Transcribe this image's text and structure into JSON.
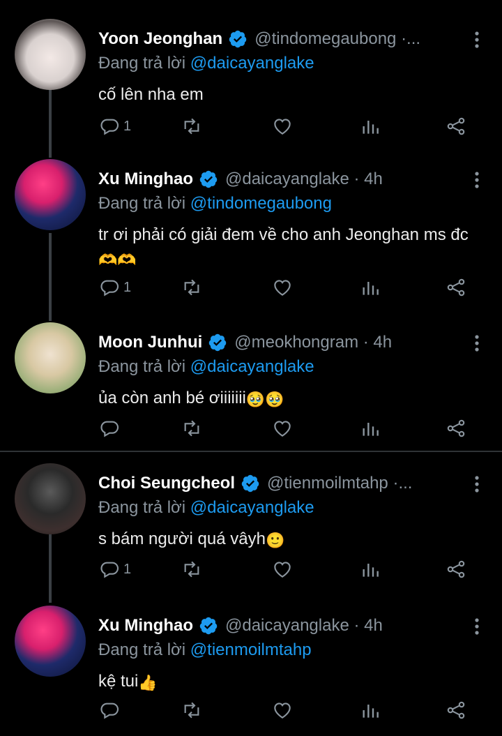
{
  "replying_prefix": "Đang trả lời",
  "tweets": [
    {
      "name": "Yoon Jeonghan",
      "handle": "@tindomegaubong ·...",
      "replying_to": "@daicayanglake",
      "text": "cố lên nha em",
      "reply_count": "1"
    },
    {
      "name": "Xu Minghao",
      "handle": "@daicayanglake · 4h",
      "replying_to": "@tindomegaubong",
      "text": "tr ơi phải có giải đem về cho anh Jeonghan ms đc",
      "emoji": "🫶🫶",
      "reply_count": "1"
    },
    {
      "name": "Moon Junhui",
      "handle": "@meokhongram · 4h",
      "replying_to": "@daicayanglake",
      "text": "ủa còn anh bé ơiiiiiii",
      "emoji": "🥹🥹",
      "reply_count": ""
    },
    {
      "name": "Choi Seungcheol",
      "handle": "@tienmoilmtahp ·...",
      "replying_to": "@daicayanglake",
      "text": "s bám người quá vâyh",
      "emoji": "🙂",
      "reply_count": "1"
    },
    {
      "name": "Xu Minghao",
      "handle": "@daicayanglake · 4h",
      "replying_to": "@tienmoilmtahp",
      "text": "kệ tui",
      "emoji": "👍",
      "reply_count": ""
    }
  ],
  "colors": {
    "background": "#000000",
    "link": "#1d9bf0",
    "muted": "#8b959e",
    "verified": "#1d9bf0"
  },
  "icons": [
    "reply-icon",
    "retweet-icon",
    "like-icon",
    "views-icon",
    "share-icon",
    "verified-badge-icon",
    "more-options-icon"
  ]
}
